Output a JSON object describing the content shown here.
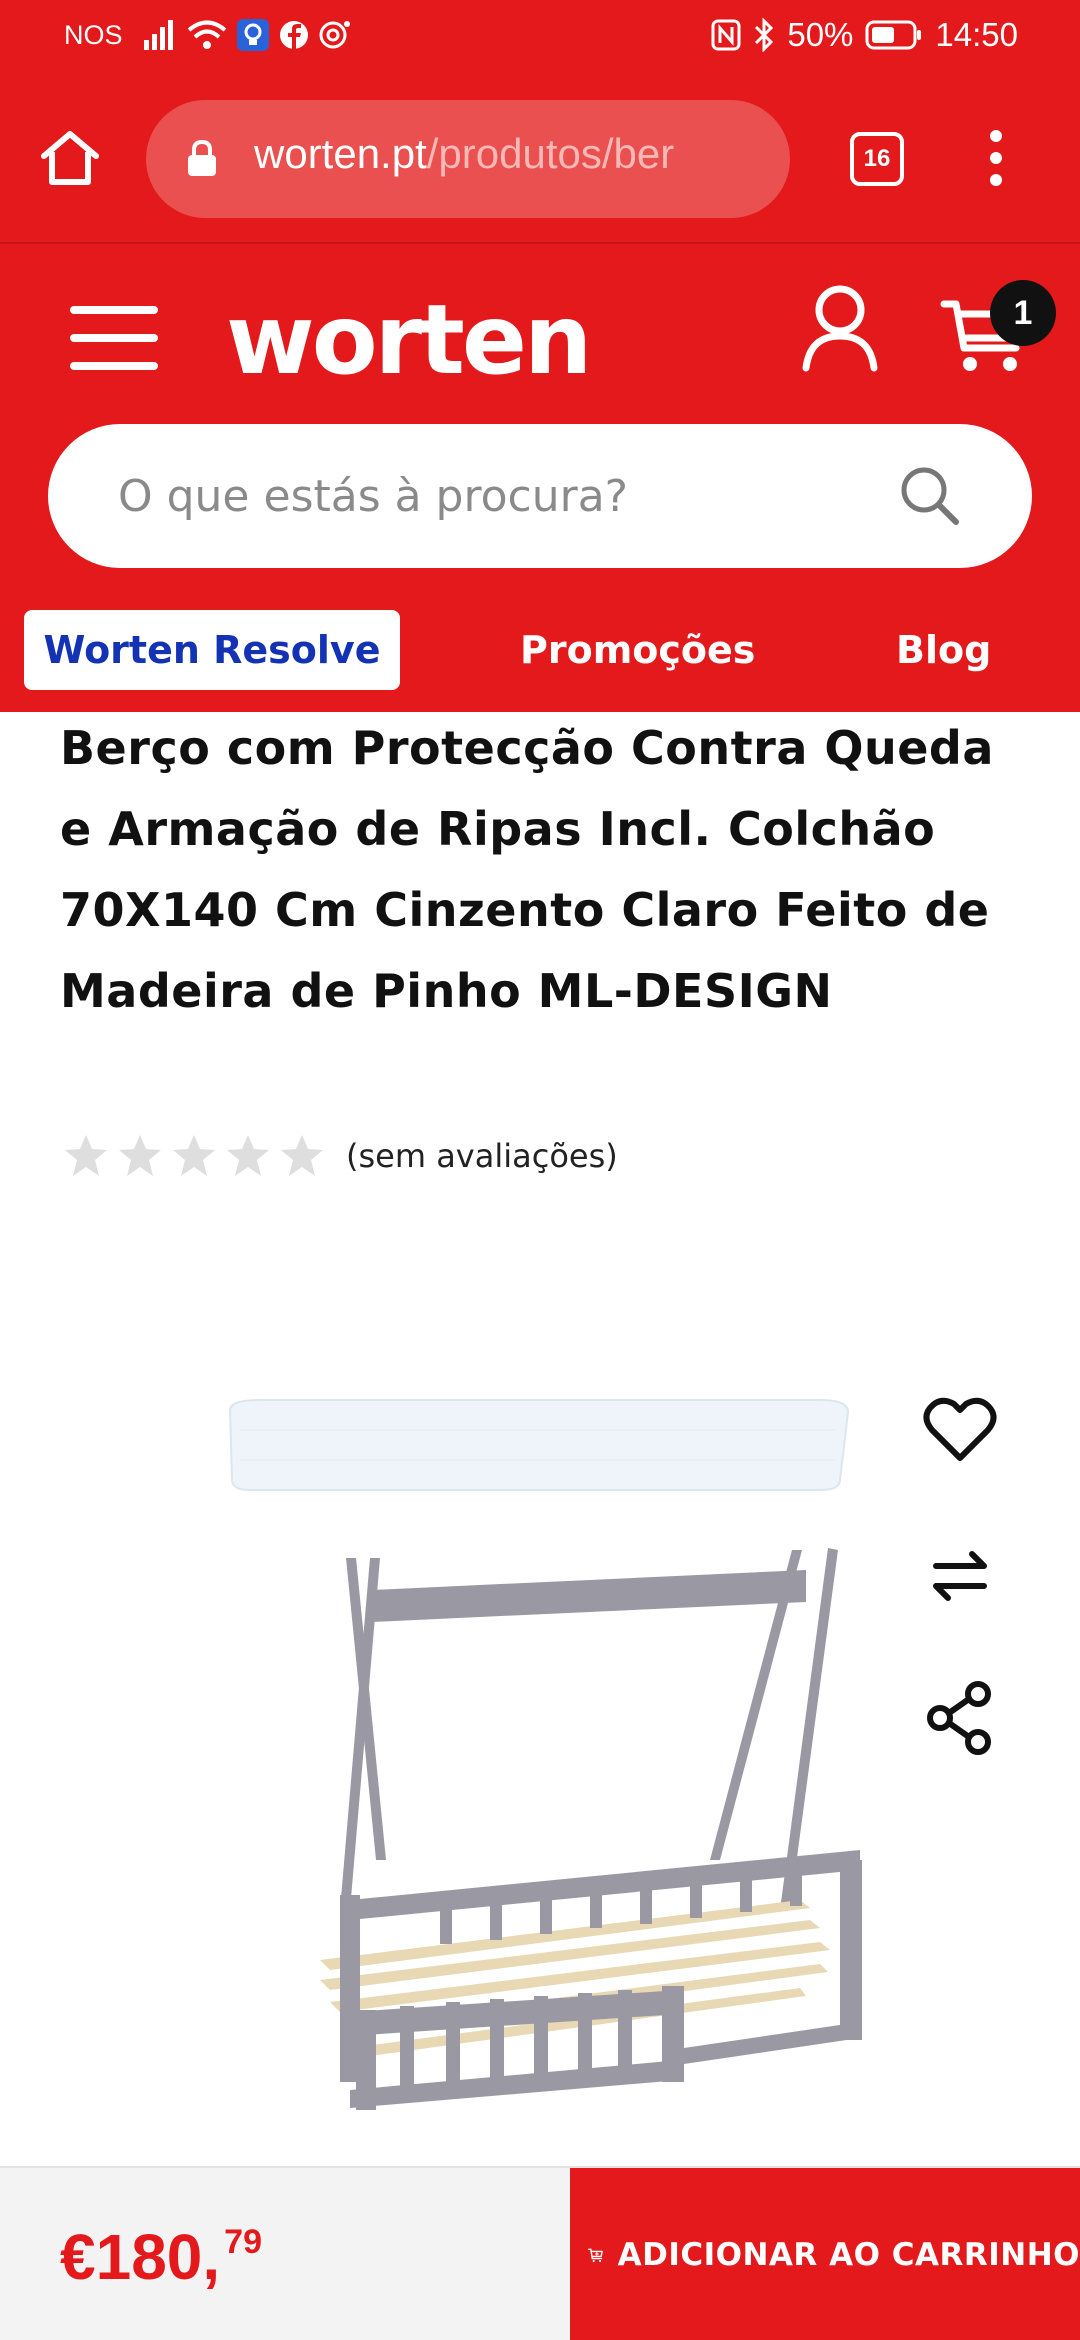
{
  "status_bar": {
    "carrier": "NOS",
    "battery": "50%",
    "time": "14:50"
  },
  "browser": {
    "url_domain": "worten.pt",
    "url_path": "/produtos/ber",
    "tab_count": "16"
  },
  "header": {
    "logo": "worten",
    "cart_count": "1",
    "search_placeholder": "O que estás à procura?",
    "nav": {
      "resolve": "Worten Resolve",
      "promotions": "Promoções",
      "blog": "Blog"
    }
  },
  "product": {
    "title": "Berço com Protecção Contra Queda e Armação de Ripas Incl. Colchão 70X140 Cm Cinzento Claro Feito de Madeira de Pinho ML-DESIGN",
    "rating_stars": 0,
    "rating_max": 5,
    "rating_text": "(sem avaliações)"
  },
  "purchase": {
    "price_main": "€180,",
    "price_cents": "79",
    "add_to_cart": "ADICIONAR AO CARRINHO"
  },
  "colors": {
    "brand_red": "#e3191b",
    "nav_blue": "#1432b4"
  },
  "icons": [
    "home-icon",
    "lock-icon",
    "tabs-icon",
    "menu-dots-icon",
    "hamburger-icon",
    "account-icon",
    "cart-icon",
    "search-icon",
    "star-icon",
    "heart-icon",
    "compare-icon",
    "share-icon",
    "cart-add-icon"
  ]
}
